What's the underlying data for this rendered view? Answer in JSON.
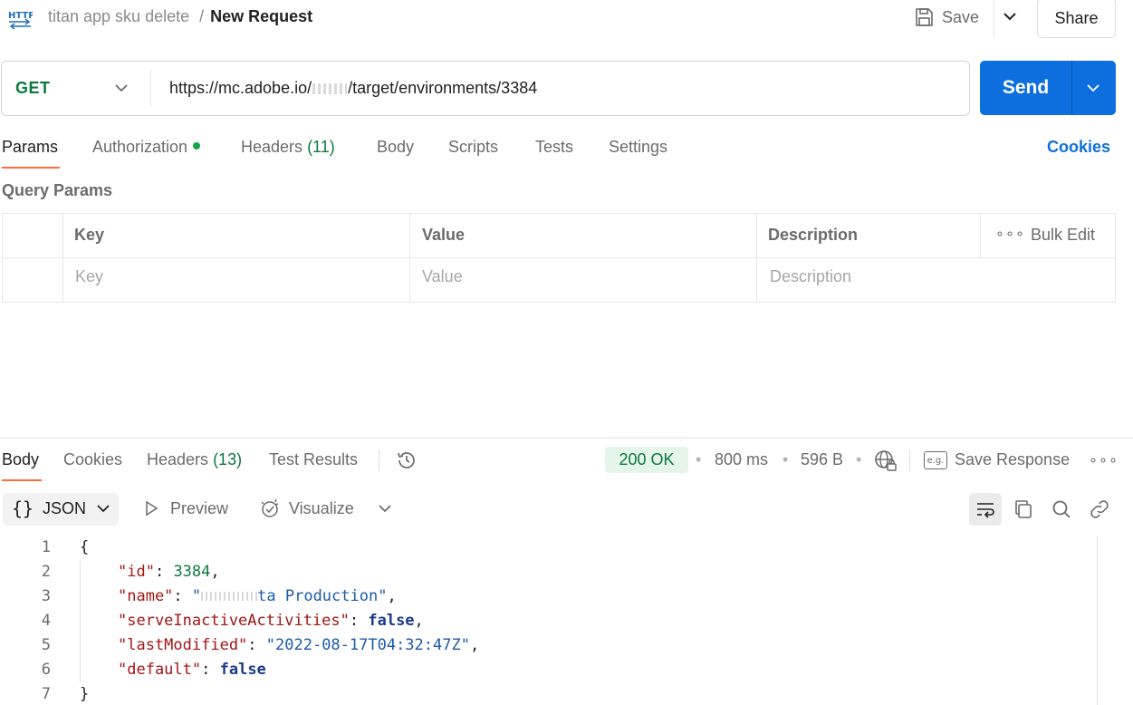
{
  "header": {
    "icon": "http-icon",
    "collection": "titan app sku delete",
    "separator": "/",
    "request_name": "New Request",
    "save_label": "Save",
    "share_label": "Share"
  },
  "urlbar": {
    "method": "GET",
    "url_prefix": "https://mc.adobe.io/",
    "url_suffix": "/target/environments/3384",
    "send_label": "Send"
  },
  "request_tabs": {
    "params": "Params",
    "authorization": "Authorization",
    "headers": "Headers",
    "headers_count": "(11)",
    "body": "Body",
    "scripts": "Scripts",
    "tests": "Tests",
    "settings": "Settings",
    "cookies": "Cookies"
  },
  "query_params": {
    "title": "Query Params",
    "columns": [
      "Key",
      "Value",
      "Description"
    ],
    "placeholders": [
      "Key",
      "Value",
      "Description"
    ],
    "more": "∘∘∘",
    "bulk_edit": "Bulk Edit"
  },
  "response": {
    "tabs": {
      "body": "Body",
      "cookies": "Cookies",
      "headers": "Headers",
      "headers_count": "(13)",
      "test_results": "Test Results"
    },
    "status": "200 OK",
    "time": "800 ms",
    "size": "596 B",
    "dot": "•",
    "eg": "e.g.",
    "save_response": "Save Response",
    "more": "∘∘∘"
  },
  "body_toolbar": {
    "format_braces": "{}",
    "format": "JSON",
    "preview": "Preview",
    "visualize": "Visualize"
  },
  "code": {
    "line_numbers": [
      "1",
      "2",
      "3",
      "4",
      "5",
      "6",
      "7"
    ],
    "brace_open": "{",
    "brace_close": "}",
    "key_id": "\"id\"",
    "val_id": "3384",
    "key_name": "\"name\"",
    "val_name_open": "\"",
    "val_name_mid": "ta Production\"",
    "key_serve": "\"serveInactiveActivities\"",
    "val_serve": "false",
    "key_modified": "\"lastModified\"",
    "val_modified": "\"2022-08-17T04:32:47Z\"",
    "key_default": "\"default\"",
    "val_default": "false",
    "colon": ": ",
    "comma": ","
  },
  "colors": {
    "accent": "#0d6fde",
    "tab_underline": "#ff6c37",
    "method_get": "#0b7a3e",
    "status_bg": "#e5f5ea"
  }
}
